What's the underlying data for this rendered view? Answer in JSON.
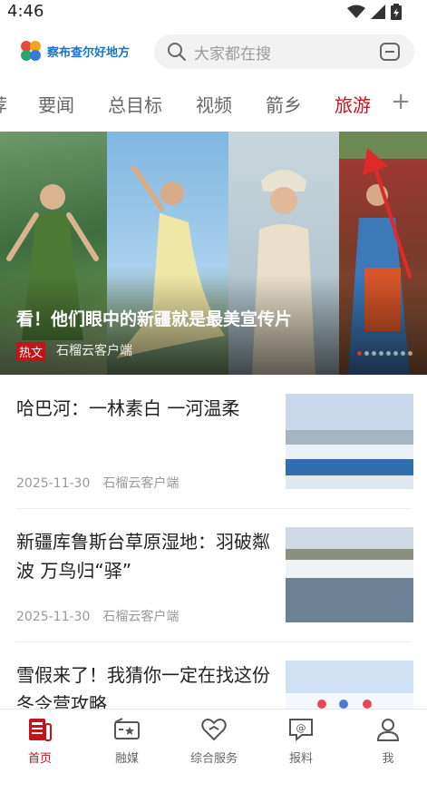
{
  "status": {
    "time": "4:46",
    "icons": [
      "wifi-icon",
      "signal-icon",
      "battery-icon"
    ]
  },
  "header": {
    "logo_text": "察布查尔好地方",
    "search_placeholder": "大家都在搜"
  },
  "tabs": [
    {
      "label": "荐",
      "active": false
    },
    {
      "label": "要闻",
      "active": false
    },
    {
      "label": "总目标",
      "active": false
    },
    {
      "label": "视频",
      "active": false
    },
    {
      "label": "箭乡",
      "active": false
    },
    {
      "label": "旅游",
      "active": true
    }
  ],
  "tab_plus": "+",
  "banner": {
    "title": "看！他们眼中的新疆就是最美宣传片",
    "tag": "热文",
    "source": "石榴云客户端",
    "slide_count": 8,
    "current_slide": 1
  },
  "news": [
    {
      "title": "哈巴河：一林素白 一河温柔",
      "date": "2025-11-30",
      "source": "石榴云客户端"
    },
    {
      "title": "新疆库鲁斯台草原湿地：羽破粼波 万鸟归“驿”",
      "date": "2025-11-30",
      "source": "石榴云客户端"
    },
    {
      "title": "雪假来了！我猜你一定在找这份冬令营攻略",
      "date": "",
      "source": ""
    }
  ],
  "bottom_nav": [
    {
      "label": "首页",
      "icon": "newspaper-icon",
      "active": true
    },
    {
      "label": "融媒",
      "icon": "media-star-icon",
      "active": false
    },
    {
      "label": "综合服务",
      "icon": "heart-service-icon",
      "active": false
    },
    {
      "label": "报料",
      "icon": "report-at-icon",
      "active": false
    },
    {
      "label": "我",
      "icon": "person-icon",
      "active": false
    }
  ],
  "colors": {
    "accent": "#c4131b",
    "logo_blue": "#1a73c9"
  }
}
